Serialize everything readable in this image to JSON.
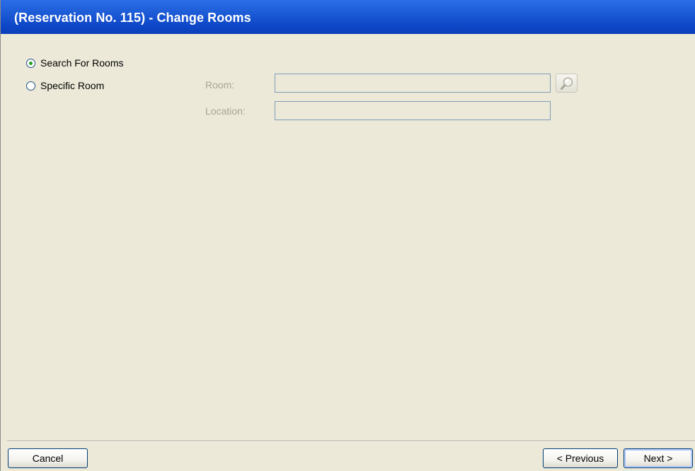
{
  "window": {
    "title": "(Reservation No. 115) - Change Rooms"
  },
  "options": {
    "search_label": "Search For Rooms",
    "search_selected": true,
    "specific_label": "Specific Room",
    "specific_selected": false
  },
  "fields": {
    "room_label": "Room:",
    "room_value": "",
    "location_label": "Location:",
    "location_value": "",
    "lookup_icon": "magnifier-icon"
  },
  "footer": {
    "cancel_label": "Cancel",
    "previous_label": "< Previous",
    "next_label": "Next >"
  },
  "colors": {
    "title_bar": "#0c45c5",
    "window_background": "#ece9d8",
    "disabled_text": "#a7a594",
    "radio_dot": "#21a121"
  }
}
